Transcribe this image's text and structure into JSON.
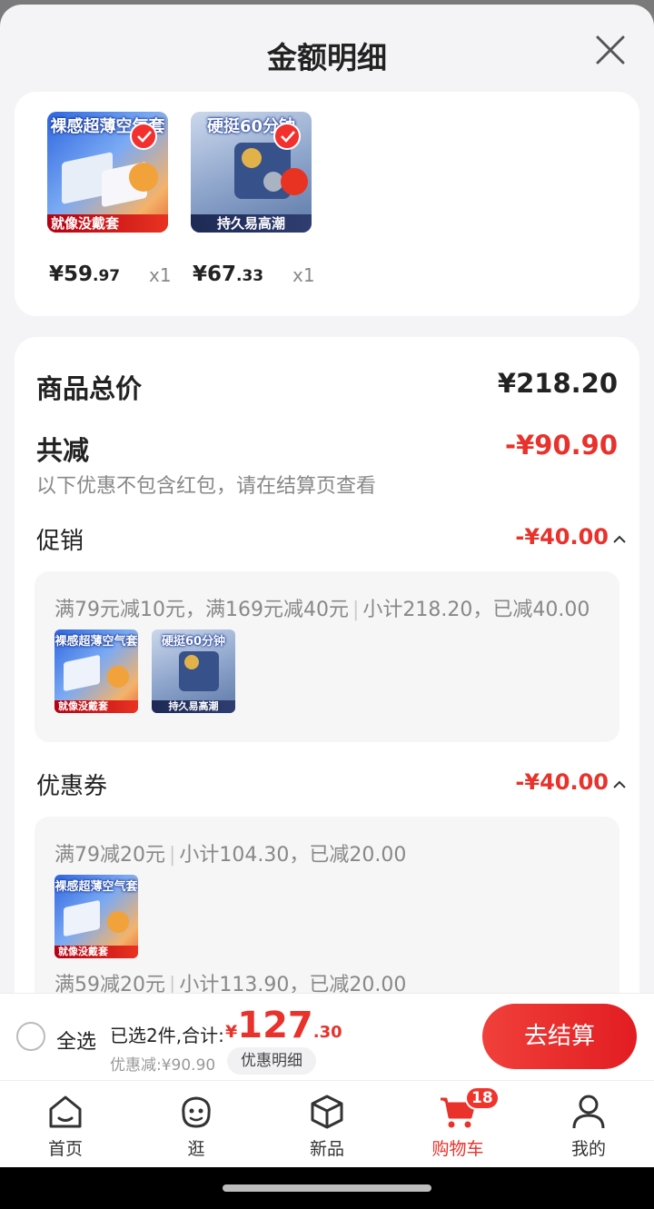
{
  "sheet": {
    "title": "金额明细"
  },
  "products": [
    {
      "thumb_title": "裸感超薄空气套",
      "thumb_bottom": "就像没戴套",
      "price_int": "¥59",
      "price_dec": ".97",
      "qty": "x1"
    },
    {
      "thumb_title": "硬挺60分钟",
      "thumb_bottom": "持久易高潮",
      "price_int": "¥67",
      "price_dec": ".33",
      "qty": "x1"
    }
  ],
  "summary": {
    "total_label": "商品总价",
    "total_value": "¥218.20",
    "reduce_label": "共减",
    "reduce_value": "-¥90.90",
    "note": "以下优惠不包含红包，请在结算页查看"
  },
  "promo": {
    "label": "促销",
    "value": "-¥40.00",
    "rule": "满79元减10元，满169元减40元",
    "subtotal": "小计218.20，已减40.00"
  },
  "coupon": {
    "label": "优惠券",
    "value": "-¥40.00",
    "rule1": "满79减20元",
    "subtotal1": "小计104.30，已减20.00",
    "rule2": "满59减20元",
    "subtotal2": "小计113.90，已减20.00"
  },
  "footer": {
    "select_all": "全选",
    "selected": "已选2件,合计:",
    "total_currency": "¥",
    "total_int": "127",
    "total_dec": ".30",
    "discount": "优惠减:¥90.90",
    "detail_button": "优惠明细",
    "checkout": "去结算"
  },
  "tabs": [
    {
      "label": "首页",
      "icon": "home-icon"
    },
    {
      "label": "逛",
      "icon": "browse-face-icon"
    },
    {
      "label": "新品",
      "icon": "box-icon"
    },
    {
      "label": "购物车",
      "icon": "cart-icon",
      "badge": "18",
      "active": true
    },
    {
      "label": "我的",
      "icon": "profile-icon"
    }
  ],
  "colors": {
    "accent": "#e8322b",
    "background": "#f4f4f6"
  }
}
